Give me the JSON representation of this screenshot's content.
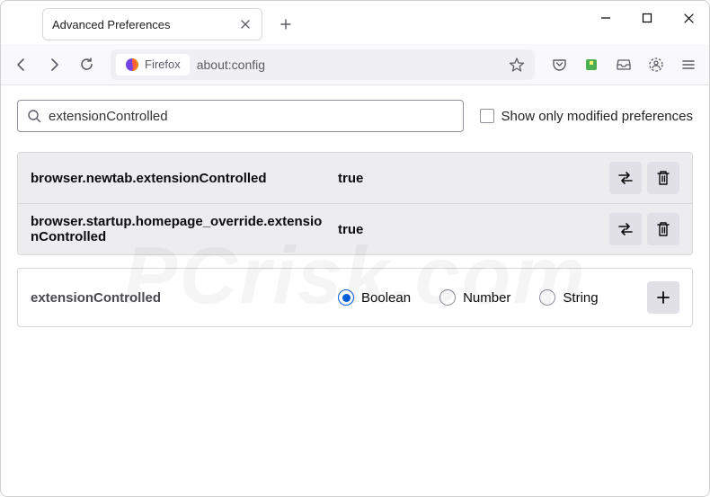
{
  "window": {
    "tab_title": "Advanced Preferences"
  },
  "addressbar": {
    "identity_label": "Firefox",
    "url": "about:config"
  },
  "search": {
    "value": "extensionControlled",
    "checkbox_label": "Show only modified preferences"
  },
  "prefs": [
    {
      "name": "browser.newtab.extensionControlled",
      "value": "true"
    },
    {
      "name": "browser.startup.homepage_override.extensionControlled",
      "value": "true"
    }
  ],
  "add_pref": {
    "name": "extensionControlled",
    "types": {
      "boolean": "Boolean",
      "number": "Number",
      "string": "String"
    }
  }
}
